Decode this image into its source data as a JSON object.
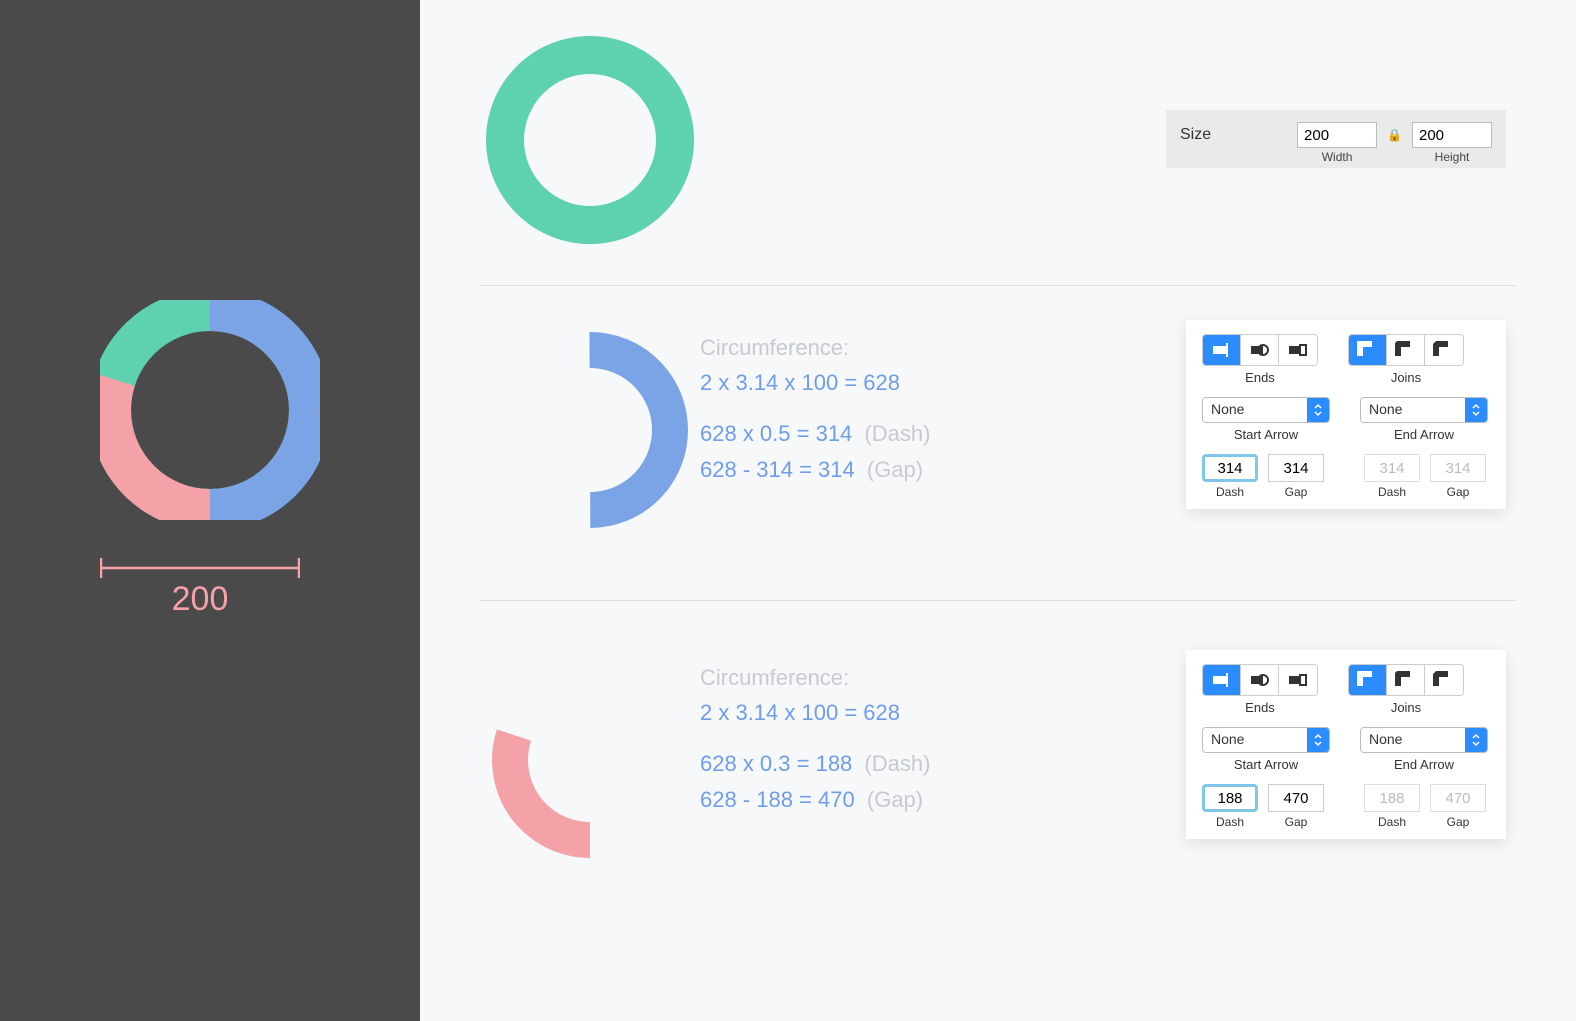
{
  "colors": {
    "teal": "#5ed1b0",
    "blue": "#7aa4e6",
    "pink": "#f4a2a8",
    "dark": "#4a4a4a",
    "accent": "#2b8cff"
  },
  "sidebar": {
    "dimension_value": "200",
    "donut_segments": [
      {
        "name": "blue",
        "fraction": 0.5,
        "color": "#7aa4e6"
      },
      {
        "name": "pink",
        "fraction": 0.3,
        "color": "#f4a2a8"
      },
      {
        "name": "teal",
        "fraction": 0.2,
        "color": "#5ed1b0"
      }
    ]
  },
  "size_panel": {
    "label": "Size",
    "width_value": "200",
    "width_label": "Width",
    "height_value": "200",
    "height_label": "Height"
  },
  "row_blue": {
    "circ_label": "Circumference:",
    "circ_formula": "2 x 3.14 x 100 = 628",
    "dash_formula": "628 x 0.5 = 314",
    "dash_tag": "(Dash)",
    "gap_formula": "628 - 314 = 314",
    "gap_tag": "(Gap)"
  },
  "row_pink": {
    "circ_label": "Circumference:",
    "circ_formula": "2 x 3.14 x 100 = 628",
    "dash_formula": "628 x 0.3 = 188",
    "dash_tag": "(Dash)",
    "gap_formula": "628 - 188 = 470",
    "gap_tag": "(Gap)"
  },
  "inspector_blue": {
    "ends_label": "Ends",
    "joins_label": "Joins",
    "start_arrow_value": "None",
    "start_arrow_label": "Start Arrow",
    "end_arrow_value": "None",
    "end_arrow_label": "End Arrow",
    "dash1_value": "314",
    "gap1_value": "314",
    "dash2_value": "314",
    "gap2_value": "314",
    "dash_label": "Dash",
    "gap_label": "Gap"
  },
  "inspector_pink": {
    "ends_label": "Ends",
    "joins_label": "Joins",
    "start_arrow_value": "None",
    "start_arrow_label": "Start Arrow",
    "end_arrow_value": "None",
    "end_arrow_label": "End Arrow",
    "dash1_value": "188",
    "gap1_value": "470",
    "dash2_value": "188",
    "gap2_value": "470",
    "dash_label": "Dash",
    "gap_label": "Gap"
  },
  "chart_data": {
    "type": "pie",
    "title": "",
    "series": [
      {
        "name": "blue",
        "value": 0.5,
        "color": "#7aa4e6"
      },
      {
        "name": "pink",
        "value": 0.3,
        "color": "#f4a2a8"
      },
      {
        "name": "teal",
        "value": 0.2,
        "color": "#5ed1b0"
      }
    ],
    "circumference": 628,
    "radius": 100,
    "diameter": 200,
    "segment_dash_gap": {
      "blue": {
        "dash": 314,
        "gap": 314
      },
      "pink": {
        "dash": 188,
        "gap": 470
      }
    }
  }
}
